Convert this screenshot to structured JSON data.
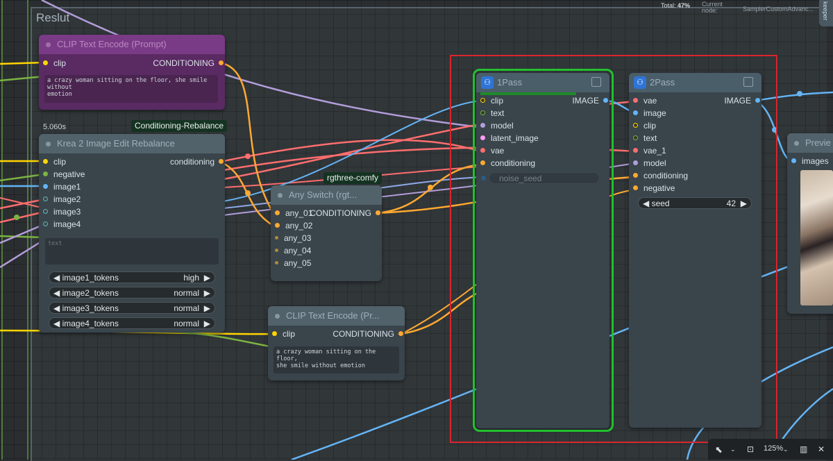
{
  "group": {
    "title": "Reslut"
  },
  "status": {
    "total_label": "Total:",
    "total_value": "47%",
    "current_label": "Current\nnode:",
    "current_node": "SamplerCustomAdvanc...",
    "side_tab": "keeper"
  },
  "clip_top": {
    "title": "CLIP Text Encode (Prompt)",
    "in_clip": "clip",
    "out": "CONDITIONING",
    "text": "a crazy woman sitting on the floor, she smile without\nemotion"
  },
  "krea": {
    "timing": "5.060s",
    "badge": "Conditioning-Rebalance",
    "title": "Krea 2 Image Edit Rebalance",
    "inputs": [
      "clip",
      "negative",
      "image1",
      "image2",
      "image3",
      "image4"
    ],
    "out": "conditioning",
    "text_placeholder": "text",
    "widgets": [
      {
        "label": "image1_tokens",
        "value": "high"
      },
      {
        "label": "image2_tokens",
        "value": "normal"
      },
      {
        "label": "image3_tokens",
        "value": "normal"
      },
      {
        "label": "image4_tokens",
        "value": "normal"
      }
    ]
  },
  "switch": {
    "tag": "rgthree-comfy",
    "title": "Any Switch (rgt...",
    "inputs": [
      "any_01",
      "any_02",
      "any_03",
      "any_04",
      "any_05"
    ],
    "out": "CONDITIONING"
  },
  "clip_bottom": {
    "title": "CLIP Text Encode (Pr...",
    "in_clip": "clip",
    "out": "CONDITIONING",
    "text": "a crazy woman sitting on the floor,\nshe smile without emotion"
  },
  "pass1": {
    "title": "1Pass",
    "inputs": [
      "clip",
      "text",
      "model",
      "latent_image",
      "vae",
      "conditioning"
    ],
    "out": "IMAGE",
    "noise_seed": "noise_seed"
  },
  "pass2": {
    "title": "2Pass",
    "inputs": [
      "vae",
      "image",
      "clip",
      "text",
      "vae_1",
      "model",
      "conditioning",
      "negative"
    ],
    "out": "IMAGE",
    "seed_label": "seed",
    "seed_value": "42"
  },
  "preview": {
    "title": "Previe",
    "in_images": "images"
  },
  "bottombar": {
    "zoom": "125%"
  },
  "colors": {
    "clip": "#ffd500",
    "cond": "#ffa931",
    "image": "#64b5f6",
    "vae": "#ff6e6e",
    "model": "#b39ddb",
    "latent": "#ff9cf9",
    "text": "#7cb342",
    "highlight_red": "#d8262c",
    "highlight_green": "#22c02f"
  }
}
